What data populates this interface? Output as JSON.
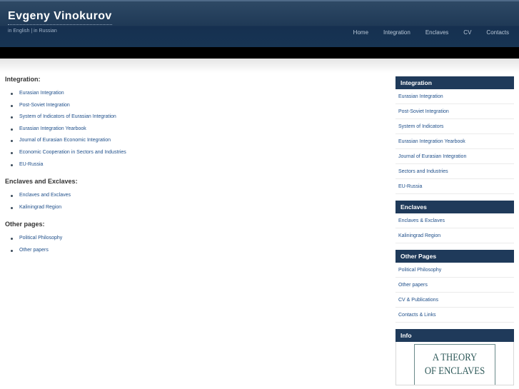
{
  "header": {
    "title": "Evgeny Vinokurov",
    "lang_english": "in English",
    "lang_sep": "|",
    "lang_russian": "in Russian",
    "nav": [
      "Home",
      "Integration",
      "Enclaves",
      "CV",
      "Contacts"
    ]
  },
  "main": {
    "sections": [
      {
        "heading": "Integration:",
        "links": [
          "Eurasian Integration",
          "Post-Soviet Integration",
          "System of Indicators of Eurasian Integration",
          "Eurasian Integration Yearbook",
          "Journal of Eurasian Economic Integration",
          "Economic Cooperation in Sectors and Industries",
          "EU-Russia"
        ]
      },
      {
        "heading": "Enclaves and Exclaves:",
        "links": [
          "Enclaves and Exclaves",
          "Kaliningrad Region"
        ]
      },
      {
        "heading": "Other pages:",
        "links": [
          "Political Philosophy",
          "Other papers"
        ]
      }
    ]
  },
  "sidebar": {
    "boxes": [
      {
        "title": "Integration",
        "links": [
          "Eurasian Integration",
          "Post-Soviet Integration",
          "System of Indicators",
          "Eurasian Integration Yearbook",
          "Journal of Eurasian Integration",
          "Sectors and Industries",
          "EU-Russia"
        ]
      },
      {
        "title": "Enclaves",
        "links": [
          "Enclaves & Exclaves",
          "Kaliningrad Region"
        ]
      },
      {
        "title": "Other Pages",
        "links": [
          "Political Philosophy",
          "Other papers",
          "CV & Publications",
          "Contacts & Links"
        ]
      }
    ],
    "info": {
      "title": "Info",
      "book_line1": "A THEORY",
      "book_line2": "OF ENCLAVES"
    }
  },
  "colors": {
    "header_bg": "#1f3956",
    "sidebar_title_bg": "#1f3a5a",
    "link": "#1f4f8a"
  }
}
